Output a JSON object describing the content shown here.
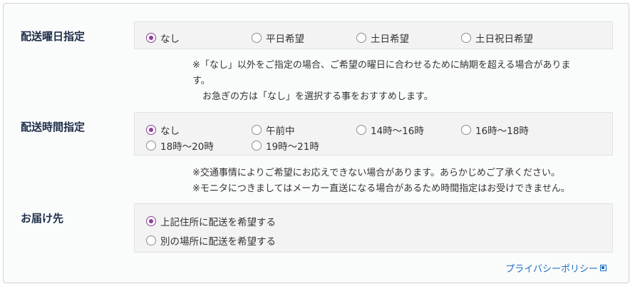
{
  "delivery_day": {
    "label": "配送曜日指定",
    "options": [
      "なし",
      "平日希望",
      "土日希望",
      "土日祝日希望"
    ],
    "selected": "なし",
    "notes": [
      "※「なし」以外をご指定の場合、ご希望の曜日に合わせるために納期を超える場合がありま",
      "す。",
      "お急ぎの方は「なし」を選択する事をおすすめします。"
    ]
  },
  "delivery_time": {
    "label": "配送時間指定",
    "options": [
      "なし",
      "午前中",
      "14時〜16時",
      "16時〜18時",
      "18時〜20時",
      "19時〜21時"
    ],
    "selected": "なし",
    "notes": [
      "※交通事情によりご希望にお応えできない場合があります。あらかじめご了承ください。",
      "※モニタにつきましてはメーカー直送になる場合があるため時間指定はお受けできません。"
    ]
  },
  "destination": {
    "label": "お届け先",
    "options": [
      "上記住所に配送を希望する",
      "別の場所に配送を希望する"
    ],
    "selected": "上記住所に配送を希望する"
  },
  "privacy_link": {
    "text": "プライバシーポリシー",
    "icon": "external-window-icon",
    "color": "#1f6fc5"
  },
  "accent_color": "#8a3f99"
}
